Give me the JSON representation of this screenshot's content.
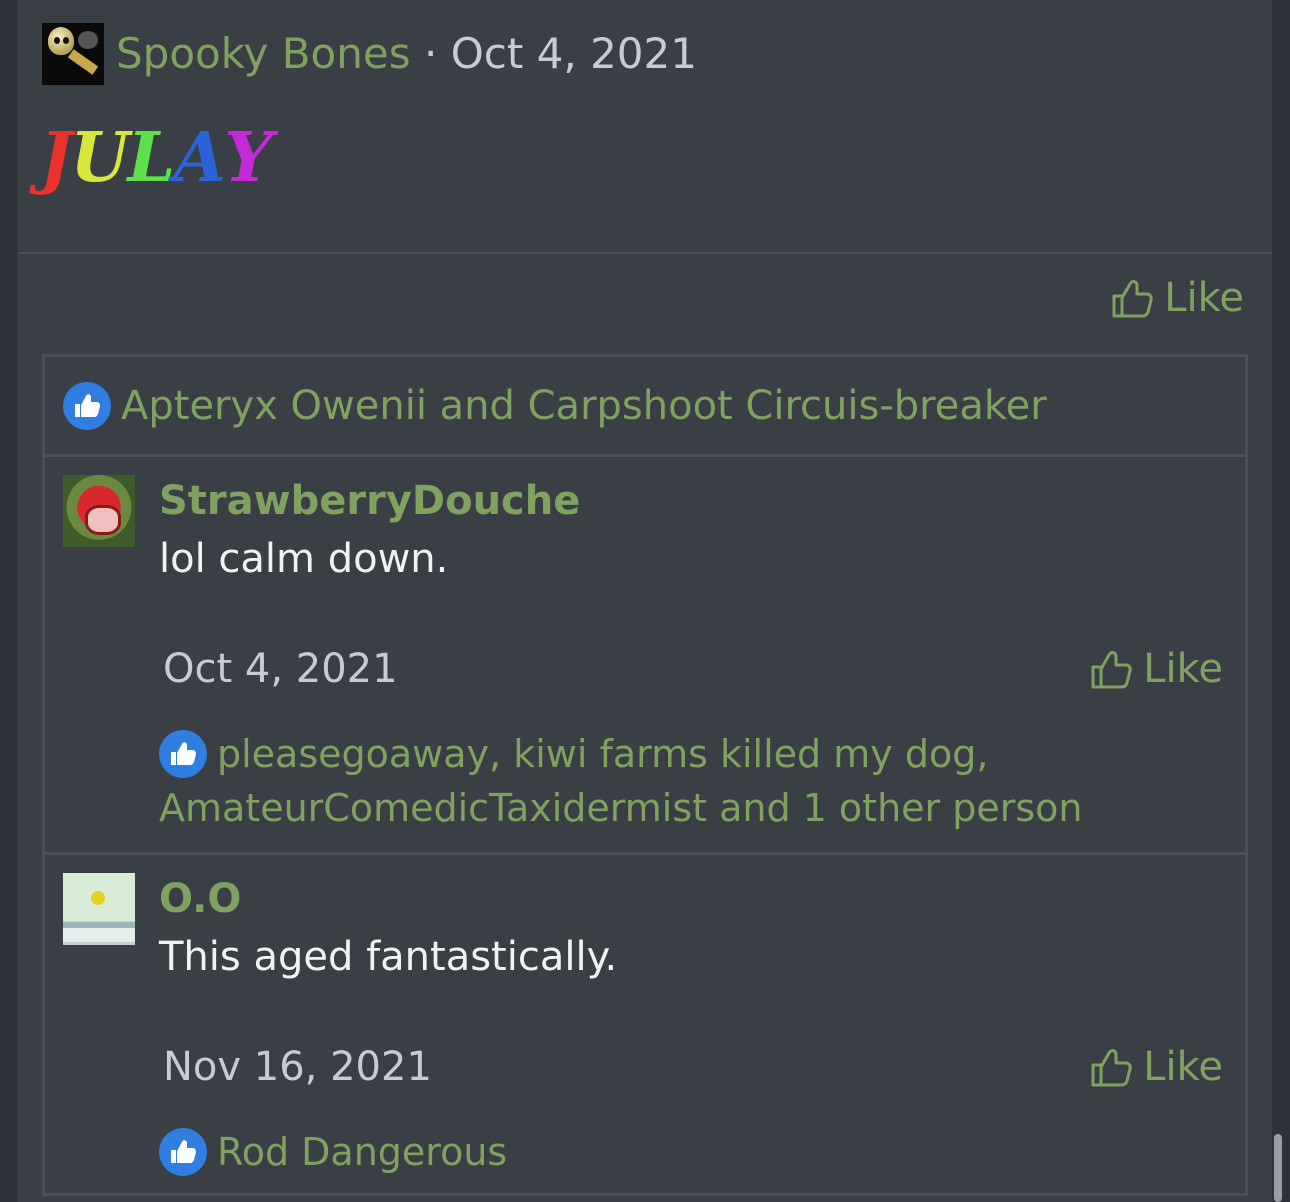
{
  "post": {
    "author": "Spooky Bones",
    "separator": "·",
    "date": "Oct 4, 2021",
    "content_letters": [
      {
        "char": "J",
        "color": "#e8322b"
      },
      {
        "char": "U",
        "color": "#d7e83a"
      },
      {
        "char": "L",
        "color": "#5ee04a"
      },
      {
        "char": "A",
        "color": "#2b62d8"
      },
      {
        "char": "Y",
        "color": "#c42ad8"
      }
    ],
    "like_label": "Like",
    "reactions": "Apteryx Owenii and Carpshoot Circuis-breaker"
  },
  "comments": [
    {
      "author": "StrawberryDouche",
      "text": "lol calm down.",
      "date": "Oct 4, 2021",
      "like_label": "Like",
      "reactions_line1": "pleasegoaway, kiwi farms killed my dog,",
      "reactions_line2": "AmateurComedicTaxidermist and 1 other person"
    },
    {
      "author": "O.O",
      "text": "This aged fantastically.",
      "date": "Nov 16, 2021",
      "like_label": "Like",
      "reactions_line1": "Rod Dangerous"
    }
  ],
  "colors": {
    "accent_green": "#7fa35f",
    "background": "#3a3e45",
    "reaction_blue": "#2f7ee0"
  }
}
